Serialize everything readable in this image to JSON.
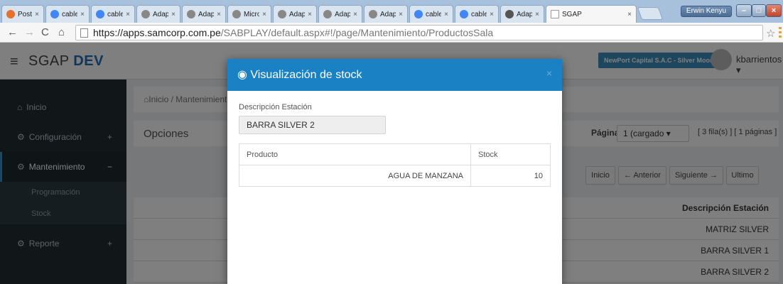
{
  "browser": {
    "tabs": [
      {
        "label": "Postm",
        "color": "#e6702d"
      },
      {
        "label": "cable",
        "color": "#4285f4"
      },
      {
        "label": "cable",
        "color": "#4285f4"
      },
      {
        "label": "Adapt",
        "color": "#888888"
      },
      {
        "label": "Adapt",
        "color": "#888888"
      },
      {
        "label": "Micro",
        "color": "#888888"
      },
      {
        "label": "Adapt",
        "color": "#888888"
      },
      {
        "label": "Adapt",
        "color": "#888888"
      },
      {
        "label": "Adapt",
        "color": "#888888"
      },
      {
        "label": "cable",
        "color": "#4285f4"
      },
      {
        "label": "cable",
        "color": "#4285f4"
      },
      {
        "label": "Adapt",
        "color": "#555555"
      },
      {
        "label": "SGAP",
        "color": "#ffffff"
      }
    ],
    "user_chip": "Erwin Kenyu",
    "url_host": "https://apps.samcorp.com.pe",
    "url_path": "/SABPLAY/default.aspx#!/page/Mantenimiento/ProductosSala"
  },
  "app": {
    "brand_prefix": "SGAP",
    "brand_suffix": "DEV",
    "company": "NewPort Capital S.A.C - Silver Moon",
    "username": "kbarrientos",
    "sidebar": {
      "items": [
        {
          "label": "Inicio",
          "icon": "home-icon"
        },
        {
          "label": "Configuración",
          "icon": "cogs-icon",
          "toggle": "+"
        },
        {
          "label": "Mantenimiento",
          "icon": "cogs-icon",
          "toggle": "−"
        },
        {
          "label": "Reporte",
          "icon": "cogs-icon",
          "toggle": "+"
        }
      ],
      "subitems": [
        "Programación",
        "Stock"
      ]
    },
    "breadcrumb": {
      "home": "Inicio",
      "separator": "/",
      "current": "Mantenimiento"
    },
    "options_title": "Opciones",
    "pager": {
      "label": "Página",
      "selected": "1 (cargado",
      "info": "[ 3 fila(s) ]   [ 1 páginas ]",
      "buttons": {
        "first": "Inicio",
        "prev": "← Anterior",
        "next": "Siguiente →",
        "last": "Ultimo"
      }
    },
    "grid": {
      "header": "Descripción Estación",
      "rows": [
        "MATRIZ SILVER",
        "BARRA SILVER 1",
        "BARRA SILVER 2"
      ]
    }
  },
  "modal": {
    "title": "Visualización de stock",
    "close": "×",
    "field_label": "Descripción Estación",
    "field_value": "BARRA SILVER 2",
    "table": {
      "headers": [
        "Producto",
        "Stock"
      ],
      "rows": [
        {
          "producto": "AGUA DE MANZANA",
          "stock": "10"
        }
      ]
    }
  }
}
